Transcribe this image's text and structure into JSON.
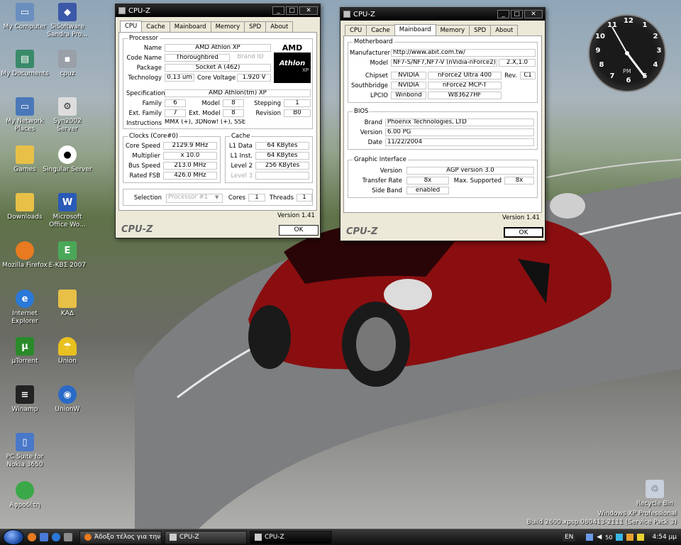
{
  "desktop": {
    "icons": [
      {
        "label": "My Computer"
      },
      {
        "label": "SiSoftware Sandra Pro..."
      },
      {
        "label": "My Documents"
      },
      {
        "label": "cpuz"
      },
      {
        "label": "My Network Places"
      },
      {
        "label": "Syn2002 Server"
      },
      {
        "label": "Games"
      },
      {
        "label": "Singular Server"
      },
      {
        "label": "Downloads"
      },
      {
        "label": "Microsoft Office Wo..."
      },
      {
        "label": "Mozilla Firefox"
      },
      {
        "label": "E-ΚΒΣ 2007"
      },
      {
        "label": "Internet Explorer"
      },
      {
        "label": "ΚΑΔ"
      },
      {
        "label": "µTorrent"
      },
      {
        "label": "Union"
      },
      {
        "label": "Winamp"
      },
      {
        "label": "UnionW"
      },
      {
        "label": "PC Suite for Nokia 3650"
      },
      {
        "label": "Αφροδίτη"
      }
    ],
    "recycle_bin": "Recycle Bin",
    "watermark_line1": "Windows XP Professional",
    "watermark_line2": "Build 2600.xpsp.080413-2111 (Service Pack 3)",
    "clock_ampm": "PM"
  },
  "cpu_window": {
    "title": "CPU-Z",
    "tabs": [
      "CPU",
      "Cache",
      "Mainboard",
      "Memory",
      "SPD",
      "About"
    ],
    "processor_group": "Processor",
    "labels": {
      "name": "Name",
      "code_name": "Code Name",
      "brand_id": "Brand ID",
      "package": "Package",
      "technology": "Technology",
      "core_voltage": "Core Voltage",
      "specification": "Specification",
      "family": "Family",
      "model": "Model",
      "stepping": "Stepping",
      "ext_family": "Ext. Family",
      "ext_model": "Ext. Model",
      "revision": "Revision",
      "instructions": "Instructions"
    },
    "values": {
      "name": "AMD Athlon XP",
      "code_name": "Thoroughbred",
      "package": "Socket A (462)",
      "technology": "0.13 um",
      "core_voltage": "1.920 V",
      "specification": "AMD Athlon(tm) XP",
      "family": "6",
      "model": "8",
      "stepping": "1",
      "ext_family": "7",
      "ext_model": "8",
      "revision": "B0",
      "instructions": "MMX (+), 3DNow! (+), SSE"
    },
    "logo_amd": "AMD",
    "logo_athlon": "Athlon",
    "logo_xp": "XP",
    "clocks_group": "Clocks (Core#0)",
    "clock_labels": {
      "core_speed": "Core Speed",
      "multiplier": "Multiplier",
      "bus_speed": "Bus Speed",
      "rated_fsb": "Rated FSB"
    },
    "clock_values": {
      "core_speed": "2129.9 MHz",
      "multiplier": "x 10.0",
      "bus_speed": "213.0 MHz",
      "rated_fsb": "426.0 MHz"
    },
    "cache_group": "Cache",
    "cache_labels": {
      "l1_data": "L1 Data",
      "l1_inst": "L1 Inst.",
      "level2": "Level 2",
      "level3": "Level 3"
    },
    "cache_values": {
      "l1_data": "64 KBytes",
      "l1_inst": "64 KBytes",
      "level2": "256 KBytes"
    },
    "selection_label": "Selection",
    "selection_value": "Processor #1",
    "cores_label": "Cores",
    "cores_value": "1",
    "threads_label": "Threads",
    "threads_value": "1",
    "version": "Version 1.41",
    "brand": "CPU-Z",
    "ok": "OK"
  },
  "mb_window": {
    "title": "CPU-Z",
    "tabs": [
      "CPU",
      "Cache",
      "Mainboard",
      "Memory",
      "SPD",
      "About"
    ],
    "motherboard_group": "Motherboard",
    "labels": {
      "manufacturer": "Manufacturer",
      "model": "Model",
      "chipset": "Chipset",
      "southbridge": "Southbridge",
      "lpcio": "LPCIO",
      "rev": "Rev."
    },
    "values": {
      "manufacturer": "http://www.abit.com.tw/",
      "model": "NF7-S/NF7,NF7-V (nVidia-nForce2)",
      "model_ver": "2.X,1.0",
      "chipset_vendor": "NVIDIA",
      "chipset_model": "nForce2 Ultra 400",
      "chipset_rev": "C1",
      "sb_vendor": "NVIDIA",
      "sb_model": "nForce2 MCP-T",
      "lpcio_vendor": "Winbond",
      "lpcio_model": "W83627HF"
    },
    "bios_group": "BIOS",
    "bios_labels": {
      "brand": "Brand",
      "version": "Version",
      "date": "Date"
    },
    "bios_values": {
      "brand": "Phoenix Technologies, LTD",
      "version": "6.00 PG",
      "date": "11/22/2004"
    },
    "graphic_group": "Graphic Interface",
    "graphic_labels": {
      "version": "Version",
      "transfer_rate": "Transfer Rate",
      "max_supported": "Max. Supported",
      "side_band": "Side Band"
    },
    "graphic_values": {
      "version": "AGP version 3.0",
      "transfer_rate": "8x",
      "max_supported": "8x",
      "side_band": "enabled"
    },
    "version": "Version 1.41",
    "brand": "CPU-Z",
    "ok": "OK"
  },
  "taskbar": {
    "tasks": [
      {
        "label": "Άδοξο τέλος για την ..."
      },
      {
        "label": "CPU-Z"
      },
      {
        "label": "CPU-Z"
      }
    ],
    "lang": "EN",
    "volume": "50",
    "time": "4:54 μμ"
  }
}
